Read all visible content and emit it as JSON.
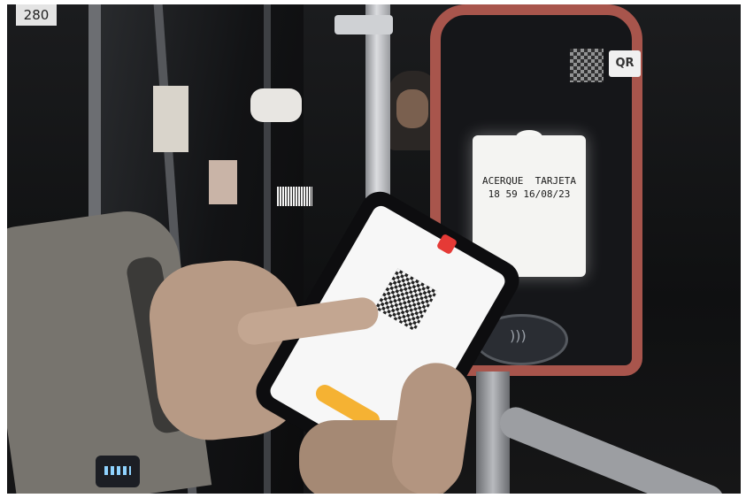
{
  "scene": {
    "bus_number_sticker": "280"
  },
  "validator": {
    "qr_tag": "QR",
    "screen_line1": "ACERQUE  TARJETA",
    "screen_line2": "18 59 16/08/23",
    "accent_color": "#a8554c"
  },
  "phone": {
    "app_color": "#e53a36",
    "button_color": "#f5b233"
  }
}
